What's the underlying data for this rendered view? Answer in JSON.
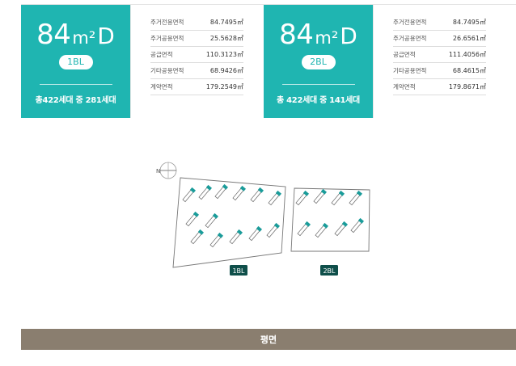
{
  "units": [
    {
      "type_num": "84",
      "type_unit": "m²",
      "type_letter": "D",
      "block": "1BL",
      "households": "총422세대 중 281세대",
      "areas": [
        {
          "label": "주거전용면적",
          "value": "84.7495㎡"
        },
        {
          "label": "주거공용면적",
          "value": "25.5628㎡"
        },
        {
          "label": "공급면적",
          "value": "110.3123㎡"
        },
        {
          "label": "기타공용면적",
          "value": "68.9426㎡"
        },
        {
          "label": "계약면적",
          "value": "179.2549㎡"
        }
      ]
    },
    {
      "type_num": "84",
      "type_unit": "m²",
      "type_letter": "D",
      "block": "2BL",
      "households": "총 422세대 중 141세대",
      "areas": [
        {
          "label": "주거전용면적",
          "value": "84.7495㎡"
        },
        {
          "label": "주거공용면적",
          "value": "26.6561㎡"
        },
        {
          "label": "공급면적",
          "value": "111.4056㎡"
        },
        {
          "label": "기타공용면적",
          "value": "68.4615㎡"
        },
        {
          "label": "계약면적",
          "value": "179.8671㎡"
        }
      ]
    }
  ],
  "map": {
    "compass_label": "N",
    "block_labels": [
      "1BL",
      "2BL"
    ]
  },
  "colors": {
    "accent": "#1fb5b1",
    "highlight_building": "#1a9c9a",
    "block_label_bg": "#0f4f4a",
    "bottom_bar": "#8a7e6f"
  },
  "footer": {
    "label": "평면"
  }
}
